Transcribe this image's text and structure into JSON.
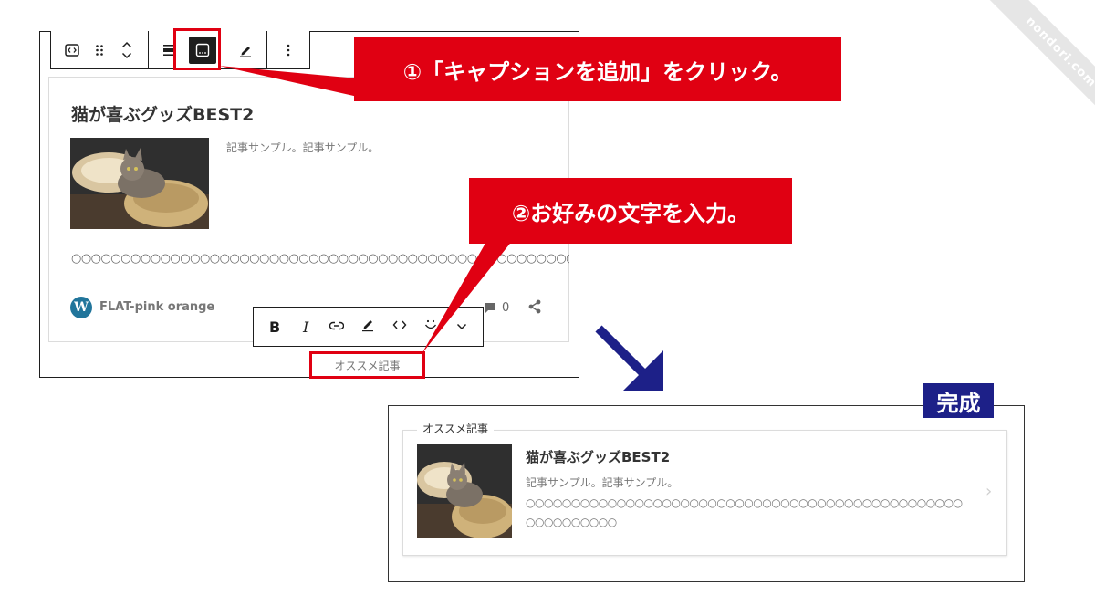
{
  "watermark": "nondori.com",
  "editor": {
    "block_toolbar": {
      "buttons": [
        {
          "icon": "code-embed-icon",
          "label": "‹›"
        },
        {
          "icon": "drag-handle-icon",
          "label": "⠿"
        },
        {
          "icon": "move-up-icon",
          "label": "︿"
        },
        {
          "icon": "move-down-icon",
          "label": "﹀"
        },
        {
          "icon": "align-icon",
          "label": "▬"
        },
        {
          "icon": "caption-icon",
          "label": "…"
        },
        {
          "icon": "pencil-icon",
          "label": "✎"
        },
        {
          "icon": "more-options-icon",
          "label": "⋮"
        }
      ]
    },
    "card": {
      "title": "猫が喜ぶグッズBEST2",
      "excerpt": "記事サンプル。記事サンプル。",
      "circles": "○○○○○○○○○○○○○○○○○○○○○○○○○○○○○○○○○○○○○○○○○○○○○○○○○○○○",
      "site_logo": "W",
      "site_name": "FLAT-pink orange",
      "comment_count": "0"
    },
    "format_toolbar": {
      "bold": "B",
      "italic": "I",
      "link": "⊖",
      "highlight": "✎",
      "code": "‹›",
      "emoji": "ᵕ̈",
      "more": "⌄"
    },
    "caption": "オススメ記事"
  },
  "callouts": {
    "step1": "①「キャプションを追加」をクリック。",
    "step2": "②お好みの文字を入力。"
  },
  "result": {
    "badge": "完成",
    "label": "オススメ記事",
    "title": "猫が喜ぶグッズBEST2",
    "excerpt": "記事サンプル。記事サンプル。",
    "circles": "○○○○○○○○○○○○○○○○○○○○○○○○○○○○○○○○○○○○○○○○○○○○○○○○○○○○○○○○○○",
    "chevron": "›"
  },
  "colors": {
    "callout_red": "#e00012",
    "badge_navy": "#1d2088",
    "arrow_navy": "#1d2088"
  }
}
